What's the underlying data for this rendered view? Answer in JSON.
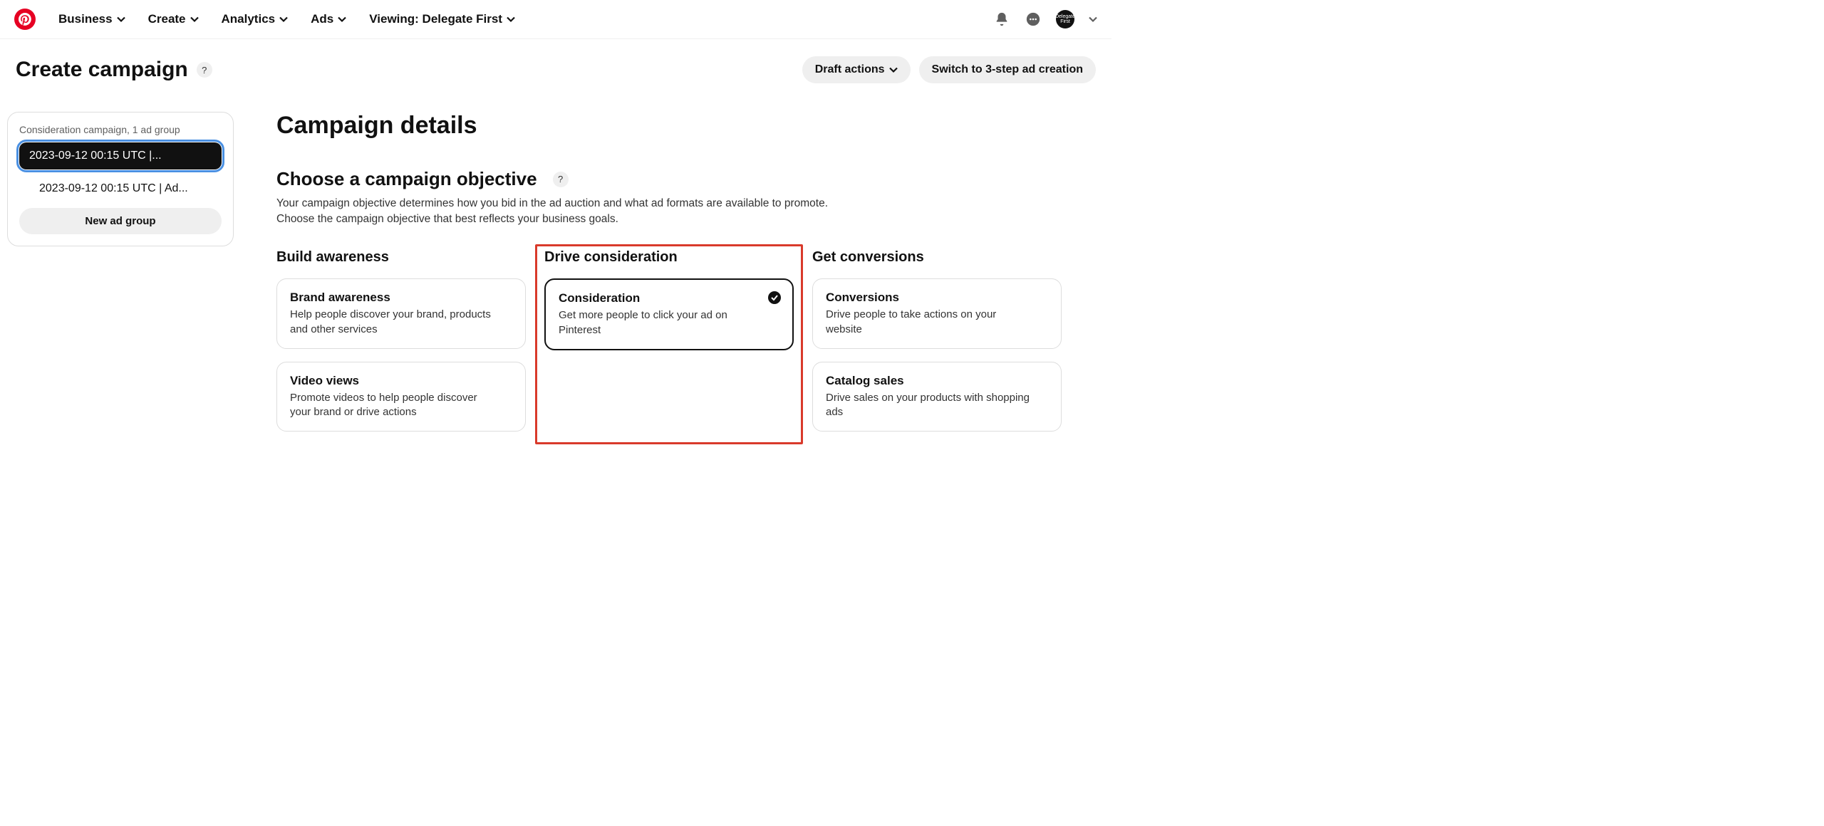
{
  "nav": {
    "business": "Business",
    "create": "Create",
    "analytics": "Analytics",
    "ads": "Ads",
    "viewing": "Viewing: Delegate First"
  },
  "header": {
    "title": "Create campaign",
    "draft_actions": "Draft actions",
    "switch": "Switch to 3-step ad creation"
  },
  "sidebar": {
    "label": "Consideration campaign, 1 ad group",
    "item_active": "2023-09-12 00:15 UTC |...",
    "item_group": "2023-09-12 00:15 UTC | Ad...",
    "new_group": "New ad group"
  },
  "main": {
    "section_title": "Campaign details",
    "objective_title": "Choose a campaign objective",
    "objective_desc_l1": "Your campaign objective determines how you bid in the ad auction and what ad formats are available to promote.",
    "objective_desc_l2": "Choose the campaign objective that best reflects your business goals."
  },
  "columns": {
    "awareness": {
      "heading": "Build awareness",
      "card1_title": "Brand awareness",
      "card1_desc": "Help people discover your brand, products and other services",
      "card2_title": "Video views",
      "card2_desc": "Promote videos to help people discover your brand or drive actions"
    },
    "consideration": {
      "heading": "Drive consideration",
      "card1_title": "Consideration",
      "card1_desc": "Get more people to click your ad on Pinterest"
    },
    "conversions": {
      "heading": "Get conversions",
      "card1_title": "Conversions",
      "card1_desc": "Drive people to take actions on your website",
      "card2_title": "Catalog sales",
      "card2_desc": "Drive sales on your products with shopping ads"
    }
  },
  "avatar_text": "Delegate First"
}
